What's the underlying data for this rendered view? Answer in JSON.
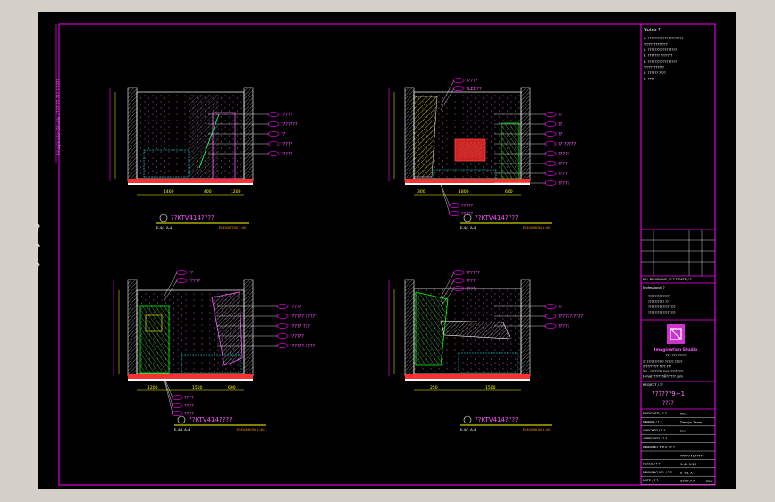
{
  "colors": {
    "background": "#000000",
    "magenta": "#ff00ff",
    "cyan": "#00ffff",
    "yellow": "#ffff00",
    "red": "#ff3030",
    "green": "#00ff00",
    "white": "#ffffff"
  },
  "sidebar_marks": [
    "?",
    "?",
    "?"
  ],
  "left_margin_text": "Imagination Studio  /  ??????  ???  ?  ????",
  "elevations": [
    {
      "title": "??KTV414????",
      "scale": "ELEVATION 1:40",
      "code": "E-4/1  A-4",
      "dims": [
        "1400",
        "400",
        "1200"
      ],
      "tags": [
        "?????",
        "???????",
        "??",
        "?????",
        "?????"
      ]
    },
    {
      "title": "??KTV414????",
      "scale": "ELEVATION 1:40",
      "code": "E-4/1  A-4",
      "dims": [
        "300",
        "1800",
        "600"
      ],
      "top_tags": [
        "?????",
        "?LED??"
      ],
      "tags": [
        "??",
        "??",
        "??",
        "?? ?????",
        "?????",
        "????",
        "????",
        "?????"
      ],
      "bottom_tags": [
        "?????",
        "?????"
      ]
    },
    {
      "title": "??KTV414????",
      "scale": "ELEVATION 1:40",
      "code": "E-4/1  A-4",
      "dims": [
        "1200",
        "1500",
        "600"
      ],
      "top_tags": [
        "??",
        "?????"
      ],
      "tags": [
        "?????",
        "?????? ?????",
        "????? ???",
        "??????",
        "?????? ????"
      ],
      "bottom_tags": [
        "????",
        "????",
        "????"
      ]
    },
    {
      "title": "??KTV414????",
      "scale": "ELEVATION 1:40",
      "code": "E-4/1  A-4",
      "dims": [
        "250",
        "1500"
      ],
      "top_tags": [
        "??????",
        "????",
        "????"
      ],
      "tags": [
        "??",
        "?????? ????",
        "?????"
      ]
    }
  ],
  "title_block": {
    "notes_heading": "Notes ?",
    "notes": [
      "1. ?????????????????????",
      "   ??????????????",
      "2. ?????????????????",
      "3. ??????? ???????",
      "4. ?????????????????",
      "   ????????????",
      "5. ?????? ????",
      "6. ????"
    ],
    "revision_label": "NO.  REVISIONS / ? ? ?     DATE / ?",
    "revision_sub": "Professional ?",
    "stamp_lines": [
      "??????????????",
      "?????????? ??",
      "?????????????????",
      "?????????????????"
    ],
    "logo_name": "Imagination Studio",
    "logo_sub": "???  ???  ?????",
    "company_lines": [
      "??  ??????????? ??? ?? ?????",
      "??????????  ????  ???",
      "TEL: ????????  FAX: ????????",
      "E-mail: ??????@??????.com"
    ],
    "project_label": "PROJECT / ??",
    "project_name": "??????9+1",
    "project_sub": "????",
    "rows": [
      {
        "label": "DESIGNED / ? ?",
        "value": "Wu"
      },
      {
        "label": "DRAWN / ? ?",
        "value": "Design Team"
      },
      {
        "label": "CHECKED / ? ?",
        "value": "Liu"
      },
      {
        "label": "APPROVED / ? ?",
        "value": ""
      },
      {
        "label": "DRAWING TITLE / ? ?",
        "value": ""
      },
      {
        "label": "",
        "value": "??KTV414????"
      },
      {
        "label": "SCALE / ? ?",
        "value": "1:40   1:20"
      },
      {
        "label": "DRAWING NO. / ? ?",
        "value": "E-4/1  A-4"
      },
      {
        "label": "DATE / ? ?",
        "value": "2009.?.?"
      }
    ],
    "rev_last": "REV."
  }
}
